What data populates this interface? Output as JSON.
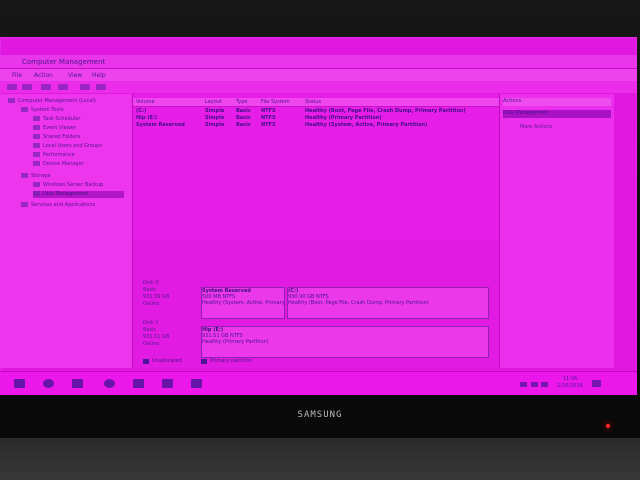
{
  "window": {
    "title": "Computer Management"
  },
  "menu": [
    {
      "label": "File"
    },
    {
      "label": "Action"
    },
    {
      "label": "View"
    },
    {
      "label": "Help"
    }
  ],
  "tree": {
    "items": [
      {
        "label": "Computer Management (Local)"
      },
      {
        "label": "System Tools"
      },
      {
        "label": "Task Scheduler"
      },
      {
        "label": "Event Viewer"
      },
      {
        "label": "Shared Folders"
      },
      {
        "label": "Local Users and Groups"
      },
      {
        "label": "Performance"
      },
      {
        "label": "Device Manager"
      },
      {
        "label": "Storage"
      },
      {
        "label": "Windows Server Backup"
      },
      {
        "label": "Disk Management"
      },
      {
        "label": "Services and Applications"
      }
    ]
  },
  "volume_table": {
    "headers": [
      "Volume",
      "Layout",
      "Type",
      "File System",
      "Status"
    ],
    "rows": [
      {
        "volume": "(C:)",
        "layout": "Simple",
        "type": "Basic",
        "fs": "NTFS",
        "status": "Healthy (Boot, Page File, Crash Dump, Primary Partition)"
      },
      {
        "volume": "Hip (E:)",
        "layout": "Simple",
        "type": "Basic",
        "fs": "NTFS",
        "status": "Healthy (Primary Partition)"
      },
      {
        "volume": "System Reserved",
        "layout": "Simple",
        "type": "Basic",
        "fs": "NTFS",
        "status": "Healthy (System, Active, Primary Partition)"
      }
    ]
  },
  "disks": [
    {
      "label_lines": [
        "Disk 0",
        "Basic",
        "931.39 GB",
        "Online"
      ],
      "partitions": [
        {
          "title": "System Reserved",
          "line1": "500 MB NTFS",
          "line2": "Healthy (System, Active, Primary Partition)"
        },
        {
          "title": "(C:)",
          "line1": "930.90 GB NTFS",
          "line2": "Healthy (Boot, Page File, Crash Dump, Primary Partition)"
        }
      ]
    },
    {
      "label_lines": [
        "Disk 1",
        "Basic",
        "931.51 GB",
        "Online"
      ],
      "partitions": [
        {
          "title": "Hip (E:)",
          "line1": "931.51 GB NTFS",
          "line2": "Healthy (Primary Partition)"
        }
      ]
    }
  ],
  "legend": [
    {
      "label": "Unallocated"
    },
    {
      "label": "Primary partition"
    }
  ],
  "actions": {
    "header": "Actions",
    "selected": "Disk Management",
    "more": "More Actions"
  },
  "taskbar": {
    "time": "11:06",
    "date": "1/16/2018"
  },
  "monitor": {
    "brand": "SAMSUNG"
  }
}
